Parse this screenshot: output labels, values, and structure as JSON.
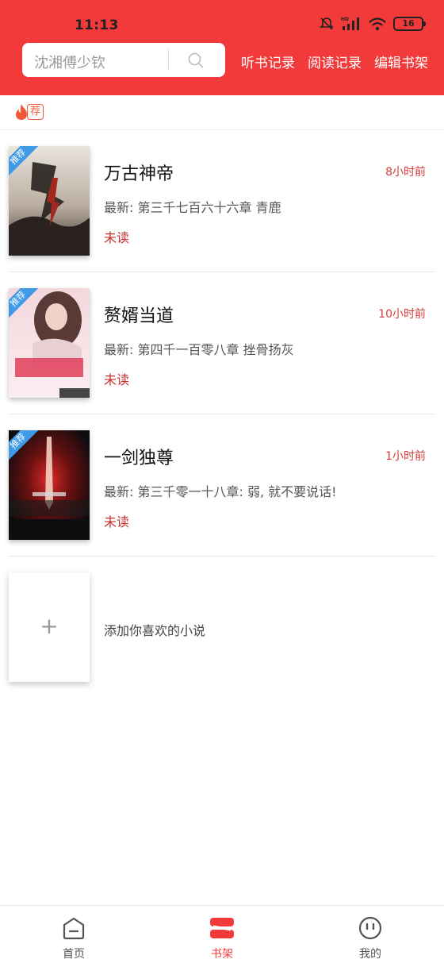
{
  "status_bar": {
    "time": "11:13",
    "battery": "16"
  },
  "search": {
    "placeholder": "沈湘傅少钦"
  },
  "top_links": [
    "听书记录",
    "阅读记录",
    "编辑书架"
  ],
  "recommend_tag": "荐",
  "books": [
    {
      "title": "万古神帝",
      "time": "8小时前",
      "latest": "最新: 第三千七百六十六章 青鹿",
      "status": "未读",
      "badge": "推荐"
    },
    {
      "title": "赘婿当道",
      "time": "10小时前",
      "latest": "最新: 第四千一百零八章 挫骨扬灰",
      "status": "未读",
      "badge": "推荐"
    },
    {
      "title": "一剑独尊",
      "time": "1小时前",
      "latest": "最新: 第三千零一十八章: 弱, 就不要说话!",
      "status": "未读",
      "badge": "推荐"
    }
  ],
  "add_book": {
    "plus": "+",
    "label": "添加你喜欢的小说"
  },
  "bottom_nav": [
    {
      "label": "首页",
      "icon": "home-icon"
    },
    {
      "label": "书架",
      "icon": "bookshelf-icon"
    },
    {
      "label": "我的",
      "icon": "profile-icon"
    }
  ],
  "colors": {
    "brand": "#f23a3a",
    "time_text": "#d93a3a",
    "unread": "#c9302c",
    "badge": "#3f9ae8"
  }
}
